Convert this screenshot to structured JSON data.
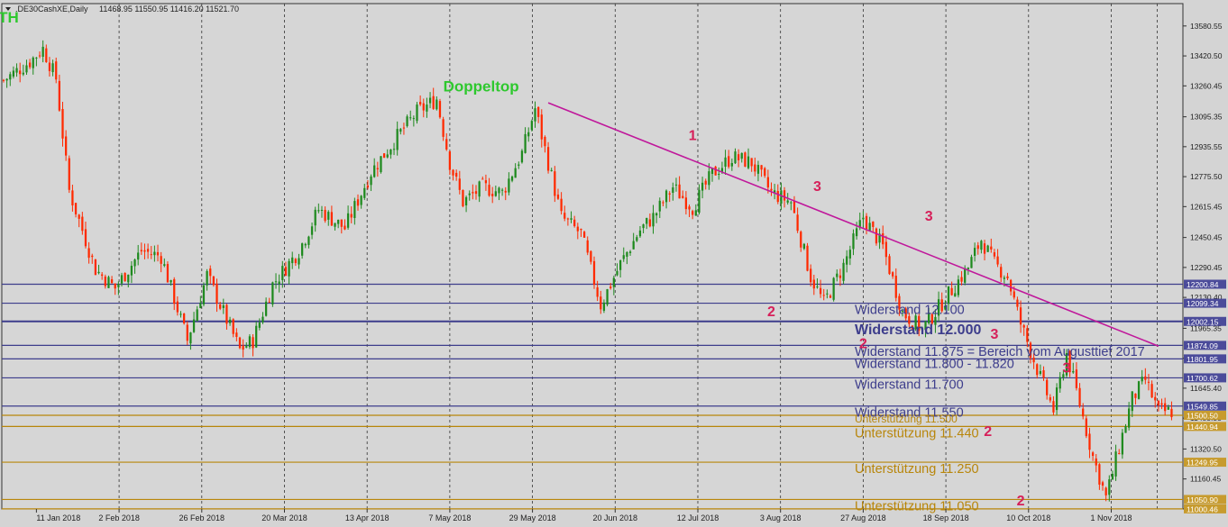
{
  "header": {
    "symbol": ".DE30CashXE,Daily",
    "ohlc": "11468.95 11550.95 11416.20 11521.70"
  },
  "colors": {
    "background": "#d4d4d4",
    "plot_area": "#d6d6d6",
    "bull_candle": "#1f8a1f",
    "bear_candle": "#ff2a00",
    "resistance_line": "#3d3d8c",
    "support_line": "#b8860b",
    "trend_line": "#c0189b",
    "label_green": "#2ec82e",
    "wave_label": "#d6205a"
  },
  "chart_data": {
    "type": "candlestick",
    "instrument": ".DE30CashXE",
    "timeframe": "Daily",
    "ylim": [
      11000,
      13700
    ],
    "y_ticks": [
      "13580.55",
      "13420.50",
      "13260.45",
      "13095.35",
      "12935.55",
      "12775.50",
      "12615.45",
      "12450.45",
      "12290.45",
      "12130.40",
      "11965.35",
      "11805.30",
      "11645.40",
      "11485.35",
      "11320.50",
      "11160.45",
      "11000.40"
    ],
    "x_ticks": [
      "11 Jan 2018",
      "2 Feb 2018",
      "26 Feb 2018",
      "20 Mar 2018",
      "13 Apr 2018",
      "7 May 2018",
      "29 May 2018",
      "20 Jun 2018",
      "12 Jul 2018",
      "3 Aug 2018",
      "27 Aug 2018",
      "18 Sep 2018",
      "10 Oct 2018",
      "1 Nov 2018"
    ],
    "close_anchors": [
      [
        0,
        13290
      ],
      [
        8,
        13390
      ],
      [
        12,
        13460
      ],
      [
        16,
        13300
      ],
      [
        20,
        12700
      ],
      [
        28,
        12280
      ],
      [
        34,
        12180
      ],
      [
        42,
        12380
      ],
      [
        48,
        12350
      ],
      [
        56,
        11900
      ],
      [
        62,
        12250
      ],
      [
        72,
        11850
      ],
      [
        76,
        11900
      ],
      [
        82,
        12200
      ],
      [
        90,
        12380
      ],
      [
        96,
        12600
      ],
      [
        104,
        12500
      ],
      [
        112,
        12800
      ],
      [
        120,
        12990
      ],
      [
        126,
        13120
      ],
      [
        132,
        13190
      ],
      [
        136,
        12850
      ],
      [
        140,
        12640
      ],
      [
        146,
        12720
      ],
      [
        152,
        12690
      ],
      [
        158,
        12900
      ],
      [
        162,
        13140
      ],
      [
        166,
        12850
      ],
      [
        170,
        12560
      ],
      [
        176,
        12470
      ],
      [
        182,
        12090
      ],
      [
        188,
        12310
      ],
      [
        194,
        12490
      ],
      [
        198,
        12560
      ],
      [
        204,
        12720
      ],
      [
        210,
        12610
      ],
      [
        216,
        12790
      ],
      [
        222,
        12880
      ],
      [
        228,
        12850
      ],
      [
        234,
        12690
      ],
      [
        240,
        12640
      ],
      [
        246,
        12240
      ],
      [
        250,
        12100
      ],
      [
        256,
        12300
      ],
      [
        262,
        12560
      ],
      [
        268,
        12400
      ],
      [
        274,
        12050
      ],
      [
        280,
        11960
      ],
      [
        286,
        12100
      ],
      [
        294,
        12290
      ],
      [
        298,
        12440
      ],
      [
        302,
        12310
      ],
      [
        306,
        12240
      ],
      [
        310,
        11990
      ],
      [
        316,
        11700
      ],
      [
        320,
        11530
      ],
      [
        324,
        11830
      ],
      [
        328,
        11560
      ],
      [
        332,
        11280
      ],
      [
        336,
        11060
      ],
      [
        340,
        11330
      ],
      [
        344,
        11590
      ],
      [
        348,
        11690
      ],
      [
        352,
        11520
      ],
      [
        356,
        11521
      ]
    ],
    "price_labels": [
      {
        "value": 12200.84,
        "text": "12200.84",
        "kind": "resistance",
        "bold": false
      },
      {
        "value": 12099.34,
        "text": "12099.34",
        "kind": "resistance",
        "bold": false
      },
      {
        "value": 12002.15,
        "text": "12002.15",
        "kind": "resistance",
        "bold": true
      },
      {
        "value": 11874.09,
        "text": "11874.09",
        "kind": "resistance",
        "bold": false
      },
      {
        "value": 11801.95,
        "text": "11801.95",
        "kind": "resistance",
        "bold": false
      },
      {
        "value": 11700.62,
        "text": "11700.62",
        "kind": "resistance",
        "bold": false
      },
      {
        "value": 11549.85,
        "text": "11549.85",
        "kind": "resistance",
        "bold": false
      },
      {
        "value": 11500.5,
        "text": "11500.50",
        "kind": "support",
        "bold": false
      },
      {
        "value": 11440.94,
        "text": "11440.94",
        "kind": "support",
        "bold": false
      },
      {
        "value": 11249.95,
        "text": "11249.95",
        "kind": "support",
        "bold": false
      },
      {
        "value": 11050.9,
        "text": "11050.90",
        "kind": "support",
        "bold": false
      },
      {
        "value": 11000.46,
        "text": "11000.46",
        "kind": "support",
        "bold": false
      }
    ],
    "level_texts": [
      {
        "text": "Widerstand 12.100",
        "value": 12100,
        "kind": "resistance",
        "size": "normal"
      },
      {
        "text": "Widerstand 12.000",
        "value": 12000,
        "kind": "resistance",
        "size": "bold"
      },
      {
        "text": "Widerstand 11.875 = Bereich vom Augusttief 2017",
        "value": 11875,
        "kind": "resistance",
        "size": "normal"
      },
      {
        "text": "Widerstand 11.800 - 11.820",
        "value": 11810,
        "kind": "resistance",
        "size": "normal"
      },
      {
        "text": "Widerstand 11.700",
        "value": 11700,
        "kind": "resistance",
        "size": "normal"
      },
      {
        "text": "Widerstand 11.550",
        "value": 11550,
        "kind": "resistance",
        "size": "normal"
      },
      {
        "text": "Unterstützung 11.500",
        "value": 11500,
        "kind": "support",
        "size": "small"
      },
      {
        "text": "Unterstützung 11.440",
        "value": 11440,
        "kind": "support",
        "size": "normal"
      },
      {
        "text": "Unterstützung 11.250",
        "value": 11250,
        "kind": "support",
        "size": "normal"
      },
      {
        "text": "Unterstützung 11.050",
        "value": 11050,
        "kind": "support",
        "size": "normal"
      }
    ],
    "trendline": {
      "from": [
        166,
        13170
      ],
      "to": [
        352,
        11870
      ]
    },
    "annotations": [
      {
        "text": "ATH",
        "bar": 0,
        "value": 13600,
        "kind": "green"
      },
      {
        "text": "Doppeltop",
        "bar": 134,
        "value": 13230,
        "kind": "green"
      },
      {
        "text": "1",
        "bar": 210,
        "value": 12970,
        "kind": "wave"
      },
      {
        "text": "2",
        "bar": 234,
        "value": 12030,
        "kind": "wave"
      },
      {
        "text": "3",
        "bar": 248,
        "value": 12700,
        "kind": "wave"
      },
      {
        "text": "2",
        "bar": 262,
        "value": 11860,
        "kind": "wave"
      },
      {
        "text": "3",
        "bar": 282,
        "value": 12540,
        "kind": "wave"
      },
      {
        "text": "3",
        "bar": 302,
        "value": 11910,
        "kind": "wave"
      },
      {
        "text": "2",
        "bar": 300,
        "value": 11390,
        "kind": "wave"
      },
      {
        "text": "3",
        "bar": 324,
        "value": 11730,
        "kind": "wave"
      },
      {
        "text": "2",
        "bar": 310,
        "value": 11020,
        "kind": "wave"
      }
    ]
  }
}
